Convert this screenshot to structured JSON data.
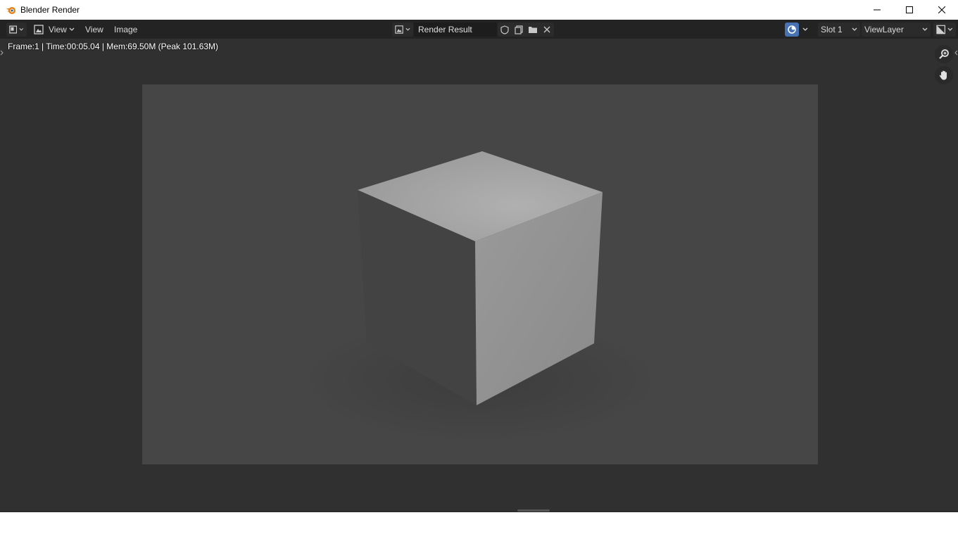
{
  "window": {
    "title": "Blender Render",
    "controls": [
      "minimize-icon",
      "maximize-icon",
      "close-icon"
    ]
  },
  "header": {
    "editor_type_icon": "image-editor-icon",
    "view_mode_label": "View",
    "menus": {
      "view": "View",
      "image": "Image"
    },
    "image_browse_icon": "image-browse-icon",
    "image_name": "Render Result",
    "image_tools": [
      "fake-user-shield-icon",
      "new-image-icon",
      "open-folder-icon",
      "unlink-close-icon"
    ],
    "gizmo_icon": "gizmo-icon",
    "slot": "Slot 1",
    "view_layer": "ViewLayer",
    "display_channels_icon": "display-channels-icon"
  },
  "status": {
    "text": "Frame:1 | Time:00:05.04 | Mem:69.50M (Peak 101.63M)"
  },
  "navigation": {
    "zoom_icon": "zoom-in-icon",
    "pan_icon": "hand-pan-icon"
  },
  "colors": {
    "editor_bg": "#303030",
    "header_bg": "#232323",
    "render_bg": "#464646",
    "accent": "#4772b3"
  }
}
